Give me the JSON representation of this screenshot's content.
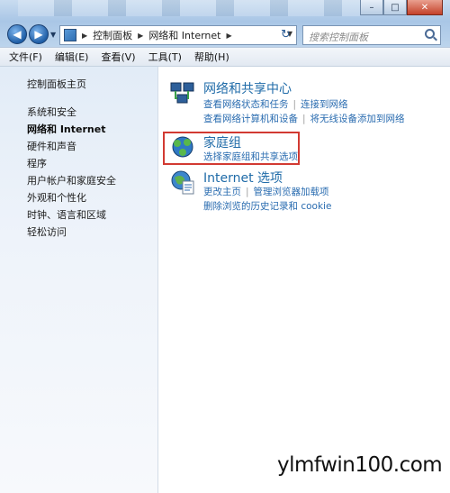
{
  "window": {
    "controls": {
      "minimize": "–",
      "maximize": "□",
      "close": "✕"
    }
  },
  "address": {
    "crumbs": [
      "控制面板",
      "网络和 Internet"
    ],
    "search_placeholder": "搜索控制面板"
  },
  "menubar": [
    "文件(F)",
    "编辑(E)",
    "查看(V)",
    "工具(T)",
    "帮助(H)"
  ],
  "sidebar": {
    "home": "控制面板主页",
    "items": [
      "系统和安全",
      "网络和 Internet",
      "硬件和声音",
      "程序",
      "用户帐户和家庭安全",
      "外观和个性化",
      "时钟、语言和区域",
      "轻松访问"
    ],
    "active_index": 1
  },
  "categories": [
    {
      "title": "网络和共享中心",
      "icon": "network-sharing-icon",
      "rows": [
        [
          "查看网络状态和任务",
          "连接到网络"
        ],
        [
          "查看网络计算机和设备",
          "将无线设备添加到网络"
        ]
      ]
    },
    {
      "title": "家庭组",
      "icon": "homegroup-icon",
      "rows": [
        [
          "选择家庭组和共享选项"
        ]
      ]
    },
    {
      "title": "Internet 选项",
      "icon": "internet-options-icon",
      "rows": [
        [
          "更改主页",
          "管理浏览器加载项"
        ],
        [
          "删除浏览的历史记录和 cookie"
        ]
      ]
    }
  ],
  "watermark": "ylmfwin100.com",
  "colors": {
    "link": "#2a6cb0",
    "title_link": "#1f6ba8",
    "highlight_border": "#d23a32"
  }
}
